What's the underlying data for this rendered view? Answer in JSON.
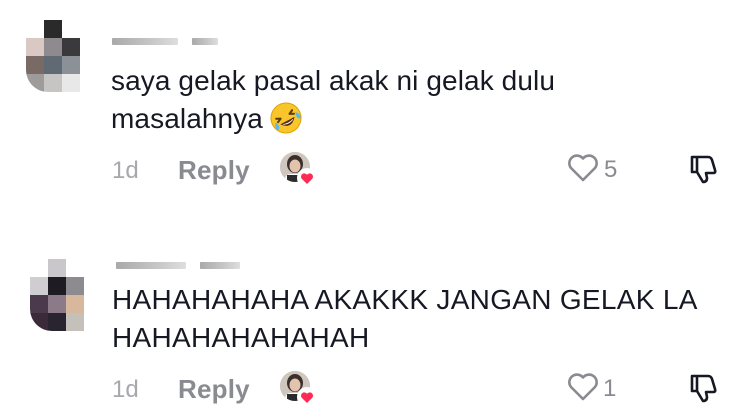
{
  "comments": [
    {
      "text": "saya gelak pasal akak ni gelak dulu masalahnya",
      "emoji": "rolling-on-floor-laughing",
      "time": "1d",
      "reply_label": "Reply",
      "like_count": "5",
      "creator_liked": true
    },
    {
      "text": "HAHAHAHAHA AKAKKK JANGAN GELAK LA HAHAHAHAHAHAH",
      "time": "1d",
      "reply_label": "Reply",
      "like_count": "1",
      "creator_liked": true
    }
  ],
  "colors": {
    "text_primary": "#161823",
    "text_secondary": "#8a8b91",
    "heart_badge": "#fe2c55"
  }
}
